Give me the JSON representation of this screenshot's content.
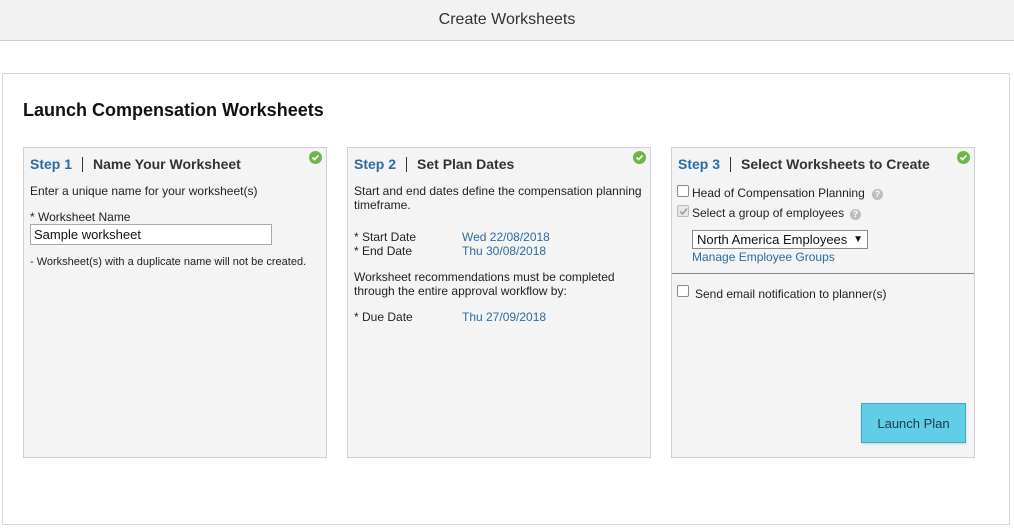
{
  "window": {
    "title": "Create Worksheets"
  },
  "page": {
    "heading": "Launch Compensation Worksheets"
  },
  "step1": {
    "num": "Step 1",
    "title": "Name Your Worksheet",
    "instruction": "Enter a unique name for your worksheet(s)",
    "field_label": "* Worksheet Name",
    "field_value": "Sample worksheet",
    "note": "- Worksheet(s) with a duplicate name will not be created."
  },
  "step2": {
    "num": "Step 2",
    "title": "Set Plan Dates",
    "intro_line1": "Start and end dates define the compensation planning",
    "intro_line2": "timeframe.",
    "start_label": "* Start Date",
    "start_value": "Wed 22/08/2018",
    "end_label": "* End Date",
    "end_value": "Thu 30/08/2018",
    "rec_line1": "Worksheet recommendations must be completed",
    "rec_line2": "through the entire approval workflow by:",
    "due_label": "* Due Date",
    "due_value": "Thu 27/09/2018"
  },
  "step3": {
    "num": "Step 3",
    "title": "Select Worksheets to Create",
    "option_head": "Head of Compensation Planning",
    "option_group": "Select a group of employees",
    "group_selected": "North America Employees",
    "manage_link": "Manage Employee Groups",
    "email_option": "Send email notification to planner(s)"
  },
  "actions": {
    "launch_label": "Launch Plan"
  },
  "colors": {
    "accent": "#2d6ca2",
    "button": "#62cde6",
    "check": "#6fb64a"
  }
}
